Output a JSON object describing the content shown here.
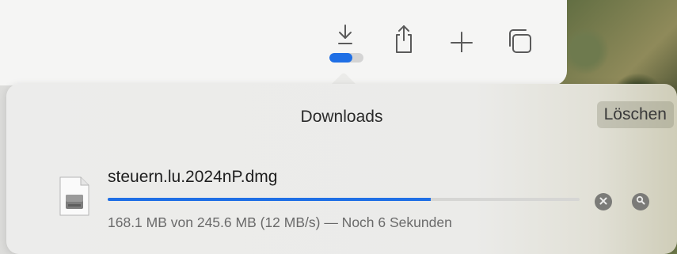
{
  "popover": {
    "title": "Downloads",
    "clear_label": "Löschen"
  },
  "toolbar": {
    "icons": [
      "download-icon",
      "share-icon",
      "plus-icon",
      "tabs-overview-icon"
    ],
    "download_progress_fraction": 0.68
  },
  "download": {
    "file_name": "steuern.lu.2024nP.dmg",
    "status": "168.1 MB von 245.6 MB (12 MB/s) — Noch 6 Sekunden",
    "progress_fraction": 0.6845
  },
  "colors": {
    "accent": "#1f6fe5",
    "round_button": "#7b7b78"
  }
}
